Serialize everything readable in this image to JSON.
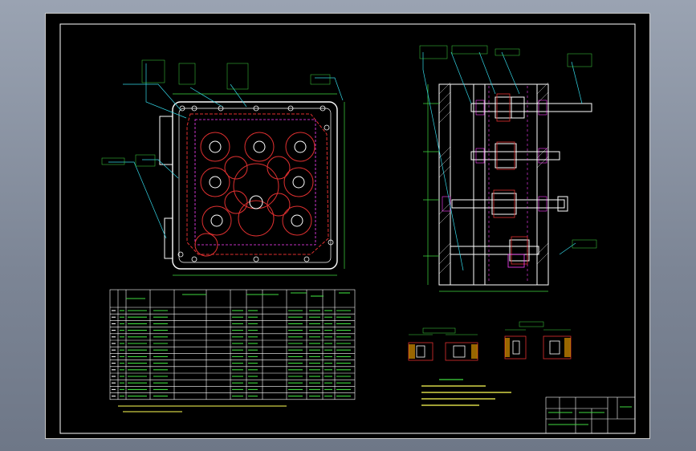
{
  "sheet": {
    "background": "#000000",
    "frame_color": "#ffffff"
  },
  "colors": {
    "outline": "#ffffff",
    "part": "#e03030",
    "dimension": "#3fd93f",
    "leader": "#33d6e6",
    "hatch": "#ff40ff",
    "note": "#ffff55"
  },
  "legend": {
    "ref_a": "1",
    "ref_b": "2"
  },
  "table": {
    "rows": 14
  },
  "title_block": {
    "label": "",
    "cell": ""
  }
}
